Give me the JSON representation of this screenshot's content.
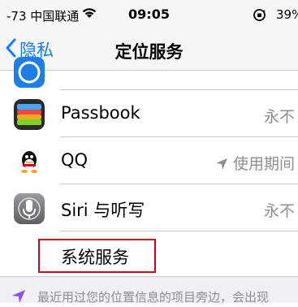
{
  "status_bar": {
    "signal": "-73",
    "carrier": "中国联通",
    "time": "09:05",
    "battery": "39%"
  },
  "nav": {
    "back_label": "隐私",
    "title": "定位服务"
  },
  "rows": [
    {
      "label": "",
      "value": "",
      "icon": "app-icon-partial"
    },
    {
      "label": "Passbook",
      "value": "永不",
      "icon": "passbook-icon"
    },
    {
      "label": "QQ",
      "value": "使用期间",
      "icon": "qq-icon",
      "location_arrow": true
    },
    {
      "label": "Siri 与听写",
      "value": "永不",
      "icon": "siri-microphone-icon"
    }
  ],
  "system_services": {
    "label": "系统服务"
  },
  "footer": {
    "note": "最近用过您的位置信息的项目旁边，会出现"
  },
  "colors": {
    "accent": "#157efb",
    "highlight_border": "#d0021b",
    "secondary_text": "#8e8e93"
  }
}
